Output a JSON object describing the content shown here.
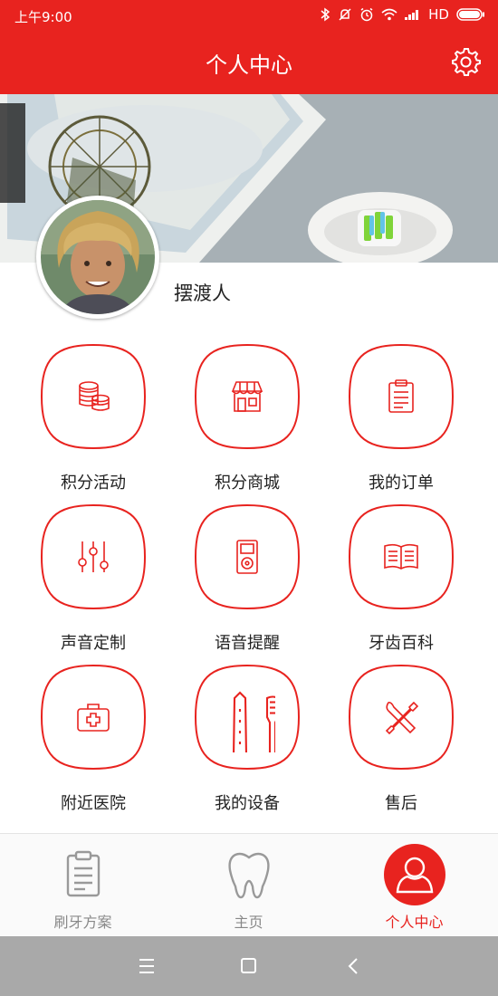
{
  "status_bar": {
    "time": "上午9:00",
    "network": "HD"
  },
  "header": {
    "title": "个人中心"
  },
  "profile": {
    "username": "摆渡人"
  },
  "menu": [
    {
      "label": "积分活动",
      "icon": "coins-icon"
    },
    {
      "label": "积分商城",
      "icon": "store-icon"
    },
    {
      "label": "我的订单",
      "icon": "clipboard-icon"
    },
    {
      "label": "声音定制",
      "icon": "equalizer-icon"
    },
    {
      "label": "语音提醒",
      "icon": "media-player-icon"
    },
    {
      "label": "牙齿百科",
      "icon": "open-book-icon"
    },
    {
      "label": "附近医院",
      "icon": "first-aid-kit-icon"
    },
    {
      "label": "我的设备",
      "icon": "electric-toothbrush-icon"
    },
    {
      "label": "售后",
      "icon": "tools-icon"
    }
  ],
  "tabs": [
    {
      "label": "刷牙方案",
      "icon": "clipboard-icon",
      "active": false
    },
    {
      "label": "主页",
      "icon": "tooth-icon",
      "active": false
    },
    {
      "label": "个人中心",
      "icon": "user-icon",
      "active": true
    }
  ],
  "colors": {
    "accent": "#e8231f",
    "inactive": "#888888",
    "navbar": "#a9a9a9"
  }
}
